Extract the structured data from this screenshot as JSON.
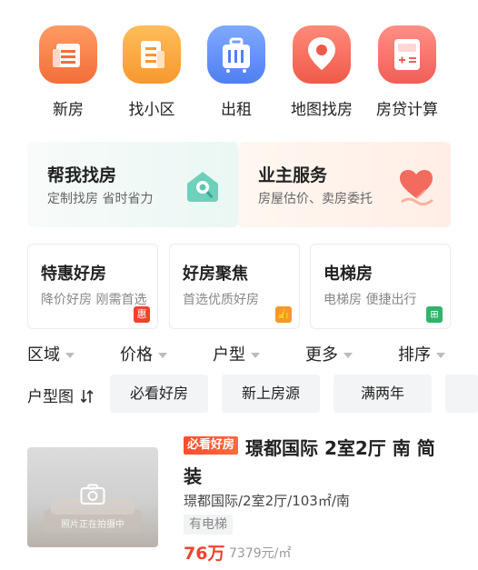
{
  "quick_nav": [
    {
      "label": "新房",
      "icon": "new-house-icon",
      "color": "#f36d3a"
    },
    {
      "label": "找小区",
      "icon": "community-icon",
      "color": "#f7982e"
    },
    {
      "label": "出租",
      "icon": "rent-suitcase-icon",
      "color": "#4f7ff2"
    },
    {
      "label": "地图找房",
      "icon": "map-pin-icon",
      "color": "#ef5a4a"
    },
    {
      "label": "房贷计算",
      "icon": "calculator-icon",
      "color": "#f25e58"
    }
  ],
  "services": [
    {
      "title": "帮我找房",
      "subtitle": "定制找房 省时省力",
      "icon": "search-house-icon"
    },
    {
      "title": "业主服务",
      "subtitle": "房屋估价、卖房委托",
      "icon": "heart-hand-icon"
    }
  ],
  "features": [
    {
      "title": "特惠好房",
      "subtitle": "降价好房 刚需首选",
      "badge": "惠",
      "badge_color": "#f0432c"
    },
    {
      "title": "好房聚焦",
      "subtitle": "首选优质好房",
      "badge": "👍",
      "badge_color": "#f7982e"
    },
    {
      "title": "电梯房",
      "subtitle": "电梯房 便捷出行",
      "badge": "⊞",
      "badge_color": "#31b46b"
    }
  ],
  "filters": [
    {
      "label": "区域"
    },
    {
      "label": "价格"
    },
    {
      "label": "户型"
    },
    {
      "label": "更多"
    },
    {
      "label": "排序"
    }
  ],
  "tag_row": {
    "lead": "户型图",
    "chips": [
      "必看好房",
      "新上房源",
      "满两年"
    ]
  },
  "listing": {
    "badge": "必看好房",
    "title": "璟都国际 2室2厅 南 简装",
    "description": "璟都国际/2室2厅/103㎡/南",
    "tag": "有电梯",
    "price": "76万",
    "unit_price": "7379元/㎡",
    "photo_caption": "照片正在拍摄中"
  },
  "colors": {
    "accent_red": "#f0432c",
    "text_primary": "#222222",
    "text_secondary": "#888888"
  }
}
